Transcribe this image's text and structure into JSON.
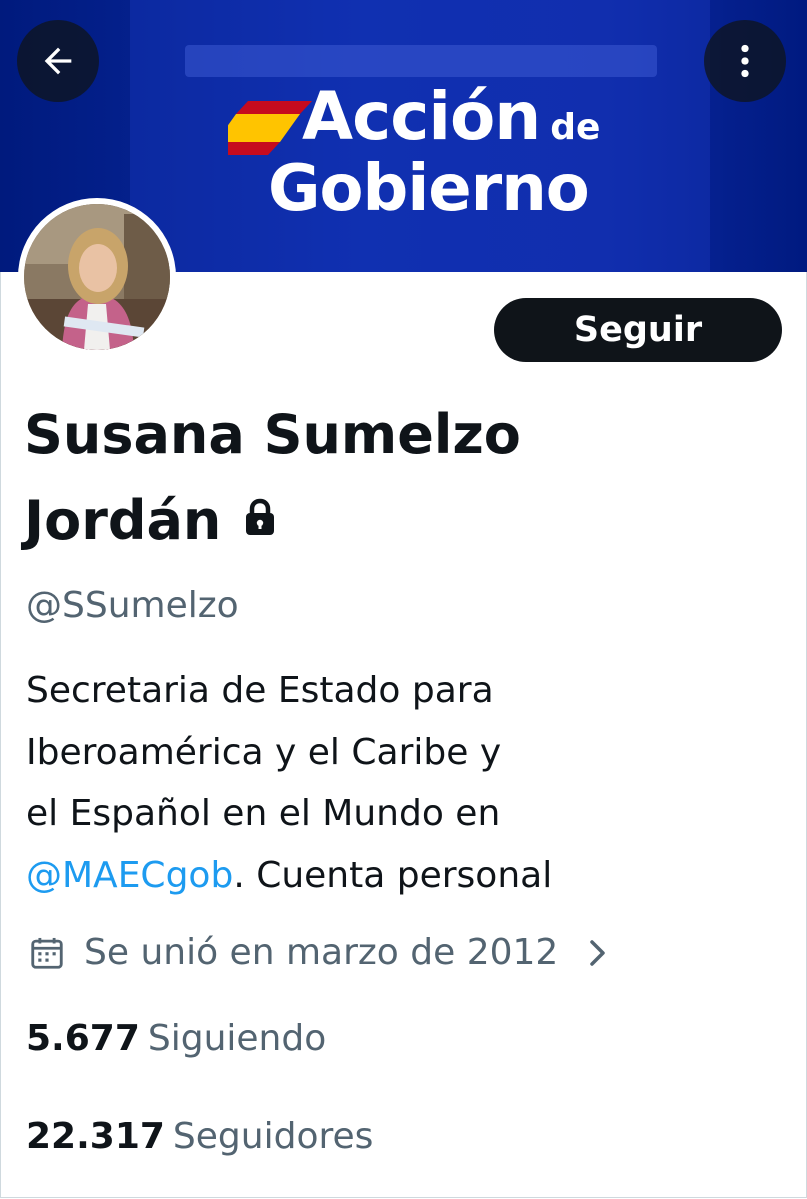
{
  "header": {
    "back_icon": "arrow-left-icon",
    "more_icon": "vertical-dots-icon",
    "banner": {
      "logo_line1": "Acción",
      "logo_de": "de",
      "logo_line2": "Gobierno",
      "flag_colors": [
        "#c60b1e",
        "#ffc400",
        "#c60b1e"
      ]
    }
  },
  "profile": {
    "follow_label": "Seguir",
    "name": "Susana Sumelzo Jordán",
    "protected_icon": "lock-icon",
    "handle": "@SSumelzo",
    "bio": {
      "line1": "Secretaria de Estado para",
      "line2": "Iberoamérica y el Caribe y",
      "line3": "el Español en el Mundo en",
      "mention": "@MAECgob",
      "after_mention": ". Cuenta personal"
    },
    "joined_icon": "calendar-icon",
    "joined": "Se unió en marzo de 2012",
    "joined_chevron_icon": "chevron-right-icon",
    "following_count": "5.677",
    "following_label": "Siguiendo",
    "followers_count": "22.317",
    "followers_label": "Seguidores"
  },
  "colors": {
    "banner_blue": "#0b27a0",
    "link": "#1d9bf0",
    "secondary_text": "#536471",
    "primary_text": "#0f1419"
  }
}
